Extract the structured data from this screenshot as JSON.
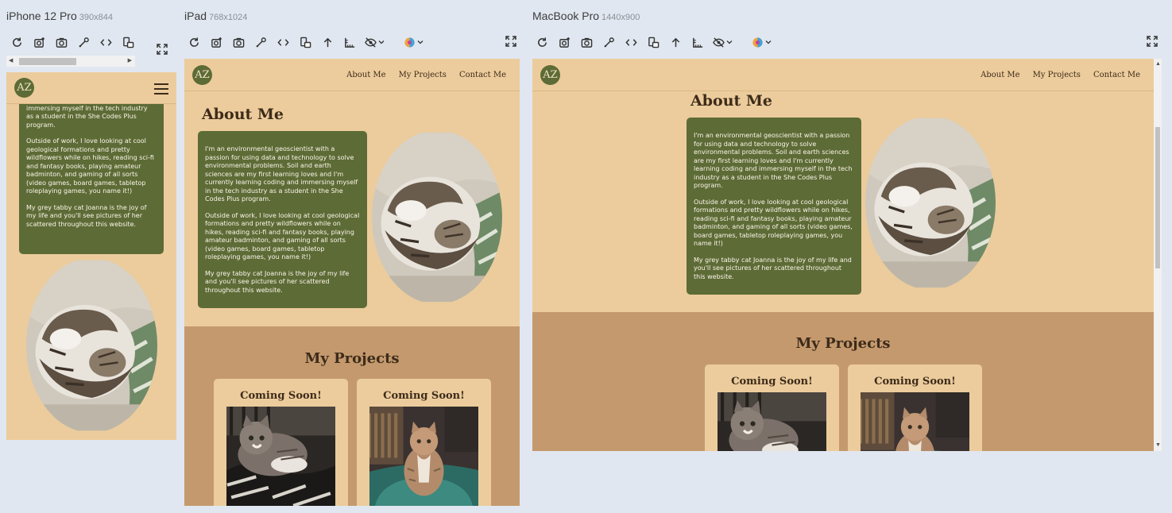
{
  "devices": {
    "iphone": {
      "name": "iPhone 12 Pro",
      "size": "390x844"
    },
    "ipad": {
      "name": "iPad",
      "size": "768x1024"
    },
    "macbook": {
      "name": "MacBook Pro",
      "size": "1440x900"
    }
  },
  "toolbar_icons": [
    "refresh-icon",
    "screenshot-icon",
    "camera-icon",
    "eyedropper-icon",
    "code-icon",
    "rotate-icon",
    "arrow-up-icon",
    "ruler-icon",
    "eye-off-icon",
    "color-vision-icon",
    "expand-icon"
  ],
  "site": {
    "logo": "AZ",
    "nav": {
      "about": "About Me",
      "projects": "My Projects",
      "contact": "Contact Me"
    },
    "about_heading": "About Me",
    "projects_heading": "My Projects",
    "bio": [
      "I'm an environmental geoscientist with a passion for using data and technology to solve environmental problems. Soil and earth sciences are my first learning loves and I'm currently learning coding and immersing myself in the tech industry as a student in the She Codes Plus program.",
      "Outside of work, I love looking at cool geological formations and pretty wildflowers while on hikes, reading sci-fi and fantasy books, playing amateur badminton, and gaming of all sorts (video games, board games, tabletop roleplaying games, you name it!)",
      "My grey tabby cat Joanna is the joy of my life and you'll see pictures of her scattered throughout this website."
    ],
    "mobile_bio_top": "and I'm currently learning coding and immersing myself in the tech industry as a student in the She Codes Plus program.",
    "project_cards": [
      {
        "title": "Coming Soon!"
      },
      {
        "title": "Coming Soon!"
      }
    ]
  },
  "colors": {
    "page_bg": "#eccc9c",
    "bio_bg": "#5d6b36",
    "projects_bg": "#c4996d",
    "heading": "#3d2b1a"
  }
}
